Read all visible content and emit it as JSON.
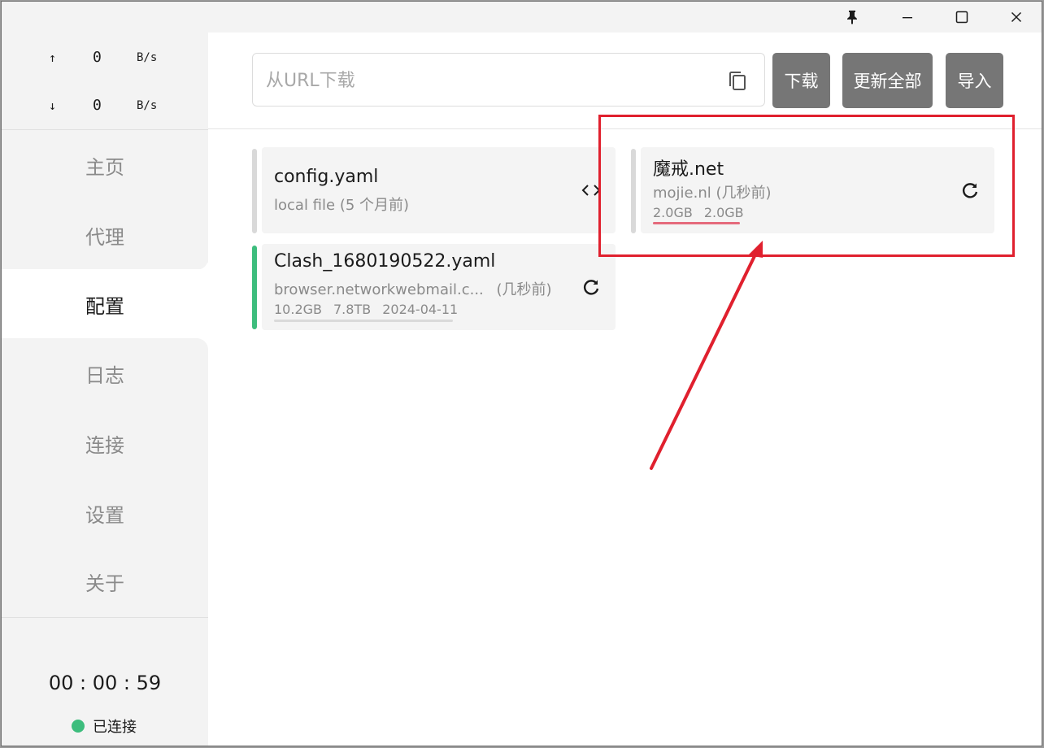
{
  "window": {
    "controls": {
      "pin_icon": "pin-icon",
      "minimize_icon": "minimize-icon",
      "maximize_icon": "maximize-icon",
      "close_icon": "close-icon"
    }
  },
  "sidebar": {
    "upload": {
      "arrow": "↑",
      "value": "0",
      "unit": "B/s"
    },
    "download": {
      "arrow": "↓",
      "value": "0",
      "unit": "B/s"
    },
    "nav": [
      {
        "label": "主页"
      },
      {
        "label": "代理"
      },
      {
        "label": "配置"
      },
      {
        "label": "日志"
      },
      {
        "label": "连接"
      },
      {
        "label": "设置"
      },
      {
        "label": "关于"
      }
    ],
    "active_index": 2,
    "timer": "00 : 00 : 59",
    "status": {
      "label": "已连接",
      "color": "#3dbd7d"
    }
  },
  "toolbar": {
    "url_placeholder": "从URL下载",
    "url_value": "",
    "download_label": "下载",
    "update_all_label": "更新全部",
    "import_label": "导入"
  },
  "profiles": [
    {
      "name": "config.yaml",
      "source": "local file",
      "time": "(5 个月前)",
      "action_icon": "code-icon",
      "active": false
    },
    {
      "name": "魔戒.net",
      "source": "mojie.nl",
      "time": "(几秒前)",
      "used": "2.0GB",
      "total": "2.0GB",
      "usage_fraction": 1.0,
      "action_icon": "refresh-icon",
      "active": false
    },
    {
      "name": "Clash_1680190522.yaml",
      "source": "browser.networkwebmail.c...",
      "time": "(几秒前)",
      "used": "10.2GB",
      "total": "7.8TB",
      "expire": "2024-04-11",
      "usage_fraction": 0.0,
      "action_icon": "refresh-icon",
      "active": true
    }
  ],
  "colors": {
    "accent_active": "#3dbd7d",
    "button_bg": "#767676",
    "annotation": "#e0202e",
    "usage_bar": "#e56a7c"
  }
}
